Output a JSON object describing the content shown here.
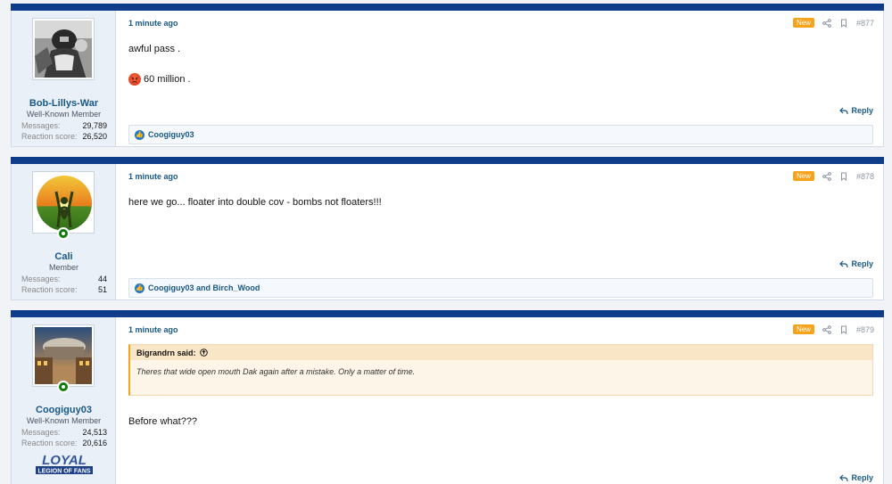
{
  "posts": [
    {
      "user": {
        "name": "Bob-Lillys-War",
        "title": "Well-Known Member",
        "stats": [
          {
            "label": "Messages:",
            "value": "29,789"
          },
          {
            "label": "Reaction score:",
            "value": "26,520"
          }
        ]
      },
      "date": "1 minute ago",
      "badge": "New",
      "number": "#877",
      "lines": [
        "awful pass .",
        "60 million ."
      ],
      "reply_label": "Reply",
      "reactions": "Coogiguy03"
    },
    {
      "user": {
        "name": "Cali",
        "title": "Member",
        "stats": [
          {
            "label": "Messages:",
            "value": "44"
          },
          {
            "label": "Reaction score:",
            "value": "51"
          }
        ]
      },
      "date": "1 minute ago",
      "badge": "New",
      "number": "#878",
      "lines": [
        "here we go... floater into double cov - bombs not floaters!!!"
      ],
      "reply_label": "Reply",
      "reactions": "Coogiguy03 and Birch_Wood"
    },
    {
      "user": {
        "name": "Coogiguy03",
        "title": "Well-Known Member",
        "stats": [
          {
            "label": "Messages:",
            "value": "24,513"
          },
          {
            "label": "Reaction score:",
            "value": "20,616"
          }
        ]
      },
      "date": "1 minute ago",
      "badge": "New",
      "number": "#879",
      "quote": {
        "author": "Bigrandrn said:",
        "text": "Theres that wide open mouth Dak again after a mistake. Only a matter of time."
      },
      "lines": [
        "Before what???"
      ],
      "reply_label": "Reply",
      "banner": {
        "line1": "LOYAL",
        "line2": "LEGION OF FANS"
      }
    }
  ],
  "colors": {
    "accent": "#185886",
    "header_bar": "#0b3a86",
    "new_badge": "#f7a21b"
  }
}
